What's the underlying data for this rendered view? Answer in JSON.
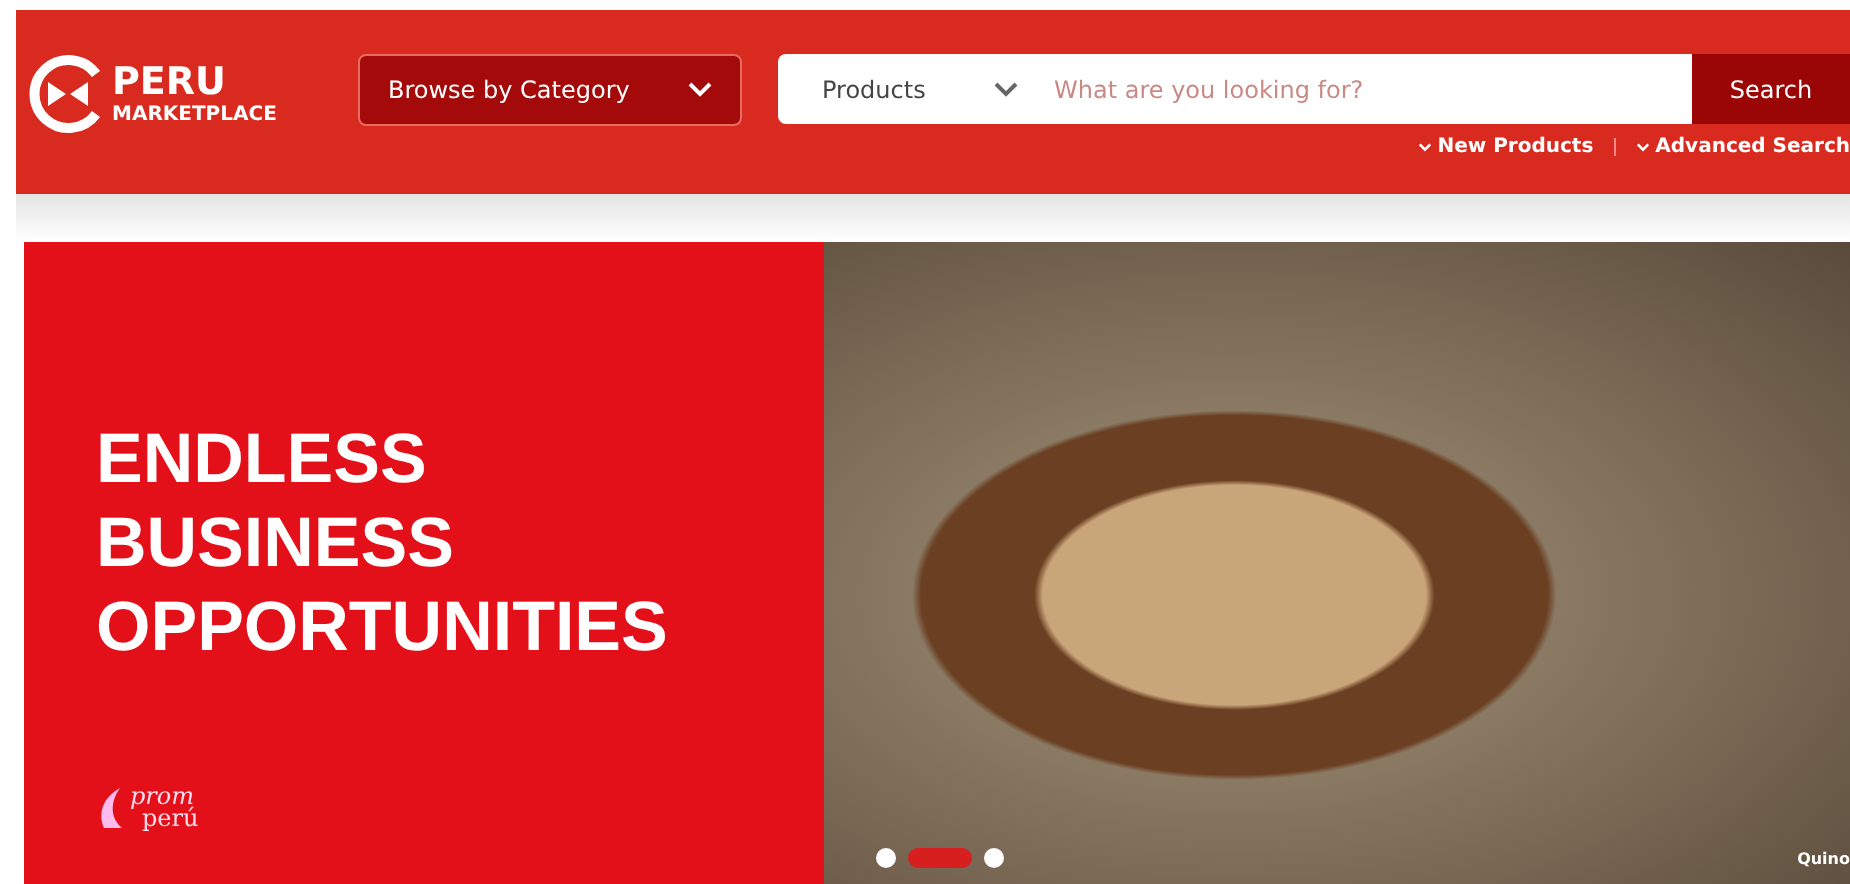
{
  "header": {
    "logo": {
      "title": "PERU",
      "subtitle": "MARKETPLACE"
    },
    "category_dropdown": {
      "label": "Browse by Category"
    },
    "search": {
      "scope": "Products",
      "placeholder": "What are you looking for?",
      "button": "Search"
    },
    "links": [
      {
        "label": "New Products"
      },
      {
        "label": "Advanced Search"
      }
    ]
  },
  "banner": {
    "headline": [
      "ENDLESS",
      "BUSINESS",
      "OPPORTUNITIES"
    ],
    "brand": {
      "line_1": "prom",
      "line_2": "perú"
    },
    "caption": "Quino",
    "dots": [
      {
        "selected": false
      },
      {
        "selected": true
      },
      {
        "selected": false
      }
    ]
  }
}
